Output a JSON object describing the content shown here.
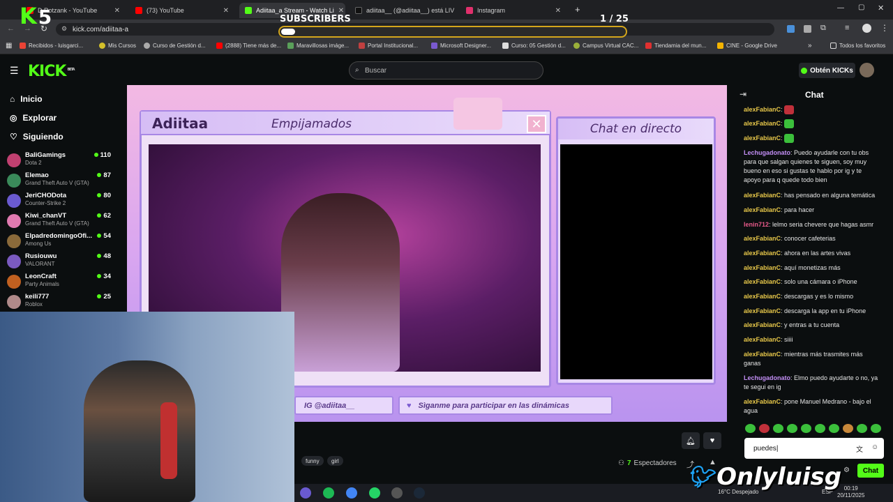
{
  "tabs": [
    {
      "title": "D Rotzank - YouTube",
      "color": "#ff0000"
    },
    {
      "title": "(73) YouTube",
      "color": "#ff0000"
    },
    {
      "title": "Adiitaa_a Stream - Watch Li",
      "color": "#53fc18"
    },
    {
      "title": "adiitaa__ (@adiitaa__) está LIVE",
      "color": "#111111"
    },
    {
      "title": "Instagram",
      "color": "#e1306c"
    }
  ],
  "url": "kick.com/adiitaa-a",
  "bookmarks": [
    "Recibidos - luisgarci...",
    "Mis Cursos",
    "Curso de Gestión d...",
    "(2888) Tiene más de...",
    "Maravillosas imáge...",
    "Portal Institucional...",
    "Microsoft Designer...",
    "Curso: 05 Gestión d...",
    "Campus Virtual CAC...",
    "Tiendamia del mun...",
    "CINE - Google Drive",
    "Todos los favoritos"
  ],
  "header": {
    "logo": "KICK",
    "logo_badge": "BETA",
    "search_placeholder": "Buscar",
    "obten": "Obtén KICKs"
  },
  "nav": [
    "Inicio",
    "Explorar",
    "Siguiendo"
  ],
  "channels": [
    {
      "name": "BaliGamings",
      "game": "Dota 2",
      "viewers": "110",
      "color": "#c04070"
    },
    {
      "name": "Elemao",
      "game": "Grand Theft Auto V (GTA)",
      "viewers": "87",
      "color": "#3a8a5a"
    },
    {
      "name": "JeriCHODota",
      "game": "Counter-Strike 2",
      "viewers": "80",
      "color": "#6a5ad0"
    },
    {
      "name": "Kiwi_chanVT",
      "game": "Grand Theft Auto V (GTA)",
      "viewers": "62",
      "color": "#e07ab0"
    },
    {
      "name": "ElpadredomingoOfi...",
      "game": "Among Us",
      "viewers": "54",
      "color": "#8a6a3a"
    },
    {
      "name": "Rusiouwu",
      "game": "VALORANT",
      "viewers": "48",
      "color": "#7a5ac0"
    },
    {
      "name": "LeonCraft",
      "game": "Party Animals",
      "viewers": "34",
      "color": "#c06020"
    },
    {
      "name": "keili777",
      "game": "Roblox",
      "viewers": "25",
      "color": "#b08a8a"
    }
  ],
  "overlay": {
    "subs_label": "SUBSCRIBERS",
    "subs_count": "1 / 25",
    "subs_progress": 0.04,
    "logo_number": "5",
    "brand": "Onlyluisg"
  },
  "stream": {
    "name": "Adiitaa",
    "subtitle": "Empijamados",
    "chat_title": "Chat en directo",
    "ig": "IG @adiitaa__",
    "banner": "Sìganme para participar en las dinámicas"
  },
  "tags": [
    "funny",
    "girl"
  ],
  "viewers": {
    "count": "7",
    "label": "Espectadores"
  },
  "chat": {
    "title": "Chat",
    "messages": [
      {
        "user": "alexFabianC",
        "text": "",
        "emote": "#c0303a",
        "ucolor": "#e8c84a"
      },
      {
        "user": "alexFabianC",
        "text": "",
        "emote": "#3bbf3b",
        "ucolor": "#e8c84a"
      },
      {
        "user": "alexFabianC",
        "text": "",
        "emote": "#3bbf3b",
        "ucolor": "#e8c84a"
      },
      {
        "user": "Lechugadonato",
        "text": "Puedo ayudarle con tu obs para que salgan quienes te siguen, soy muy bueno en eso si gustas te hablo por ig y te apoyo para q quede todo bien",
        "ucolor": "#c28ef5"
      },
      {
        "user": "alexFabianC",
        "text": "has pensado en alguna temática",
        "ucolor": "#e8c84a"
      },
      {
        "user": "alexFabianC",
        "text": "para hacer",
        "ucolor": "#e8c84a"
      },
      {
        "user": "lenin712",
        "text": "lelmo seria chevere que hagas asmr",
        "ucolor": "#e85a8a"
      },
      {
        "user": "alexFabianC",
        "text": "conocer cafeterias",
        "ucolor": "#e8c84a"
      },
      {
        "user": "alexFabianC",
        "text": "ahora en las artes vivas",
        "ucolor": "#e8c84a"
      },
      {
        "user": "alexFabianC",
        "text": "aquí monetizas más",
        "ucolor": "#e8c84a"
      },
      {
        "user": "alexFabianC",
        "text": "solo una cámara o iPhone",
        "ucolor": "#e8c84a"
      },
      {
        "user": "alexFabianC",
        "text": "descargas y es lo mismo",
        "ucolor": "#e8c84a"
      },
      {
        "user": "alexFabianC",
        "text": "descarga la app en tu iPhone",
        "ucolor": "#e8c84a"
      },
      {
        "user": "alexFabianC",
        "text": "y entras a tu cuenta",
        "ucolor": "#e8c84a"
      },
      {
        "user": "alexFabianC",
        "text": "siiii",
        "ucolor": "#e8c84a"
      },
      {
        "user": "alexFabianC",
        "text": "mientras más trasmites más ganas",
        "ucolor": "#e8c84a"
      },
      {
        "user": "Lechugadonato",
        "text": "Elmo puedo ayudarte o no, ya te segui en ig",
        "ucolor": "#c28ef5"
      },
      {
        "user": "alexFabianC",
        "text": "pone Manuel Medrano - bajo el agua",
        "ucolor": "#e8c84a"
      }
    ],
    "input_value": "puedes",
    "send": "Chat"
  },
  "taskbar": {
    "weather": "16°C  Despejado",
    "time": "00:19",
    "date": "20/11/2025",
    "lang": "ESP"
  }
}
